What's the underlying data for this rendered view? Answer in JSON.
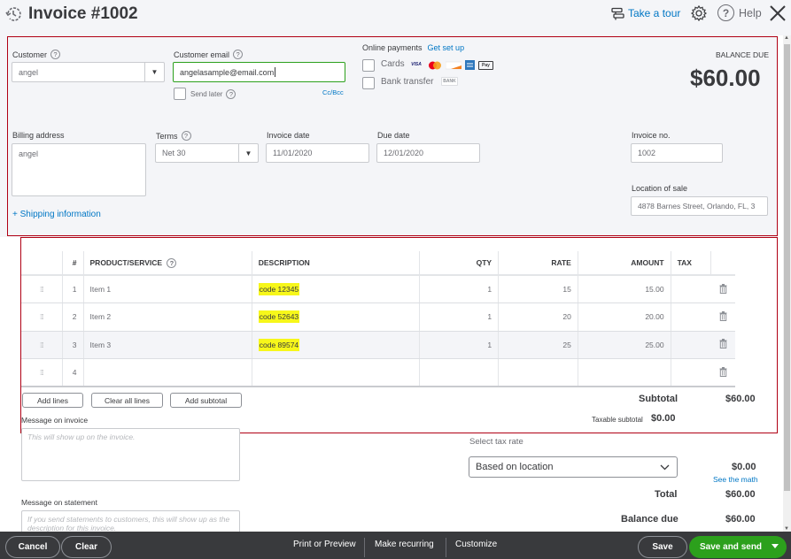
{
  "header": {
    "title": "Invoice #1002",
    "take_tour": "Take a tour",
    "help": "Help"
  },
  "customer": {
    "label": "Customer",
    "value": "angel",
    "email_label": "Customer email",
    "email_value": "angelasample@email.com",
    "send_later": "Send later",
    "cc_bcc": "Cc/Bcc"
  },
  "online_payments": {
    "label": "Online payments",
    "setup_link": "Get set up",
    "cards_label": "Cards",
    "card_logos": [
      "VISA",
      "Mastercard",
      "Discover",
      "Amex",
      "Apple Pay"
    ],
    "bank_label": "Bank transfer",
    "bank_logo": "BANK"
  },
  "balance": {
    "label": "BALANCE DUE",
    "amount": "$60.00"
  },
  "billing": {
    "label": "Billing address",
    "value": "angel",
    "shipping_link": "+ Shipping information"
  },
  "terms": {
    "label": "Terms",
    "value": "Net 30"
  },
  "invoice_date": {
    "label": "Invoice date",
    "value": "11/01/2020"
  },
  "due_date": {
    "label": "Due date",
    "value": "12/01/2020"
  },
  "invoice_no": {
    "label": "Invoice no.",
    "value": "1002"
  },
  "location": {
    "label": "Location of sale",
    "value": "4878  Barnes Street, Orlando, FL, 3"
  },
  "table": {
    "headers": {
      "num": "#",
      "product": "PRODUCT/SERVICE",
      "description": "DESCRIPTION",
      "qty": "QTY",
      "rate": "RATE",
      "amount": "AMOUNT",
      "tax": "TAX"
    },
    "rows": [
      {
        "num": "1",
        "product": "Item 1",
        "description": "code 12345",
        "qty": "1",
        "rate": "15",
        "amount": "15.00",
        "tax": ""
      },
      {
        "num": "2",
        "product": "Item 2",
        "description": "code 52643",
        "qty": "1",
        "rate": "20",
        "amount": "20.00",
        "tax": ""
      },
      {
        "num": "3",
        "product": "Item 3",
        "description": "code 89574",
        "qty": "1",
        "rate": "25",
        "amount": "25.00",
        "tax": ""
      },
      {
        "num": "4",
        "product": "",
        "description": "",
        "qty": "",
        "rate": "",
        "amount": "",
        "tax": ""
      }
    ]
  },
  "line_buttons": {
    "add_lines": "Add lines",
    "clear_all": "Clear all lines",
    "add_subtotal": "Add subtotal"
  },
  "messages": {
    "invoice_label": "Message on invoice",
    "invoice_placeholder": "This will show up on the invoice.",
    "statement_label": "Message on statement",
    "statement_placeholder": "If you send statements to customers, this will show up as the description for this invoice."
  },
  "totals": {
    "subtotal_label": "Subtotal",
    "subtotal_value": "$60.00",
    "taxable_label": "Taxable subtotal",
    "taxable_value": "$0.00",
    "tax_rate_label": "Select tax rate",
    "tax_rate_value": "Based on location",
    "tax_value": "$0.00",
    "see_math": "See the math",
    "total_label": "Total",
    "total_value": "$60.00",
    "balance_label": "Balance due",
    "balance_value": "$60.00"
  },
  "footer": {
    "cancel": "Cancel",
    "clear": "Clear",
    "print_preview": "Print or Preview",
    "make_recurring": "Make recurring",
    "customize": "Customize",
    "save": "Save",
    "save_send": "Save and send"
  }
}
